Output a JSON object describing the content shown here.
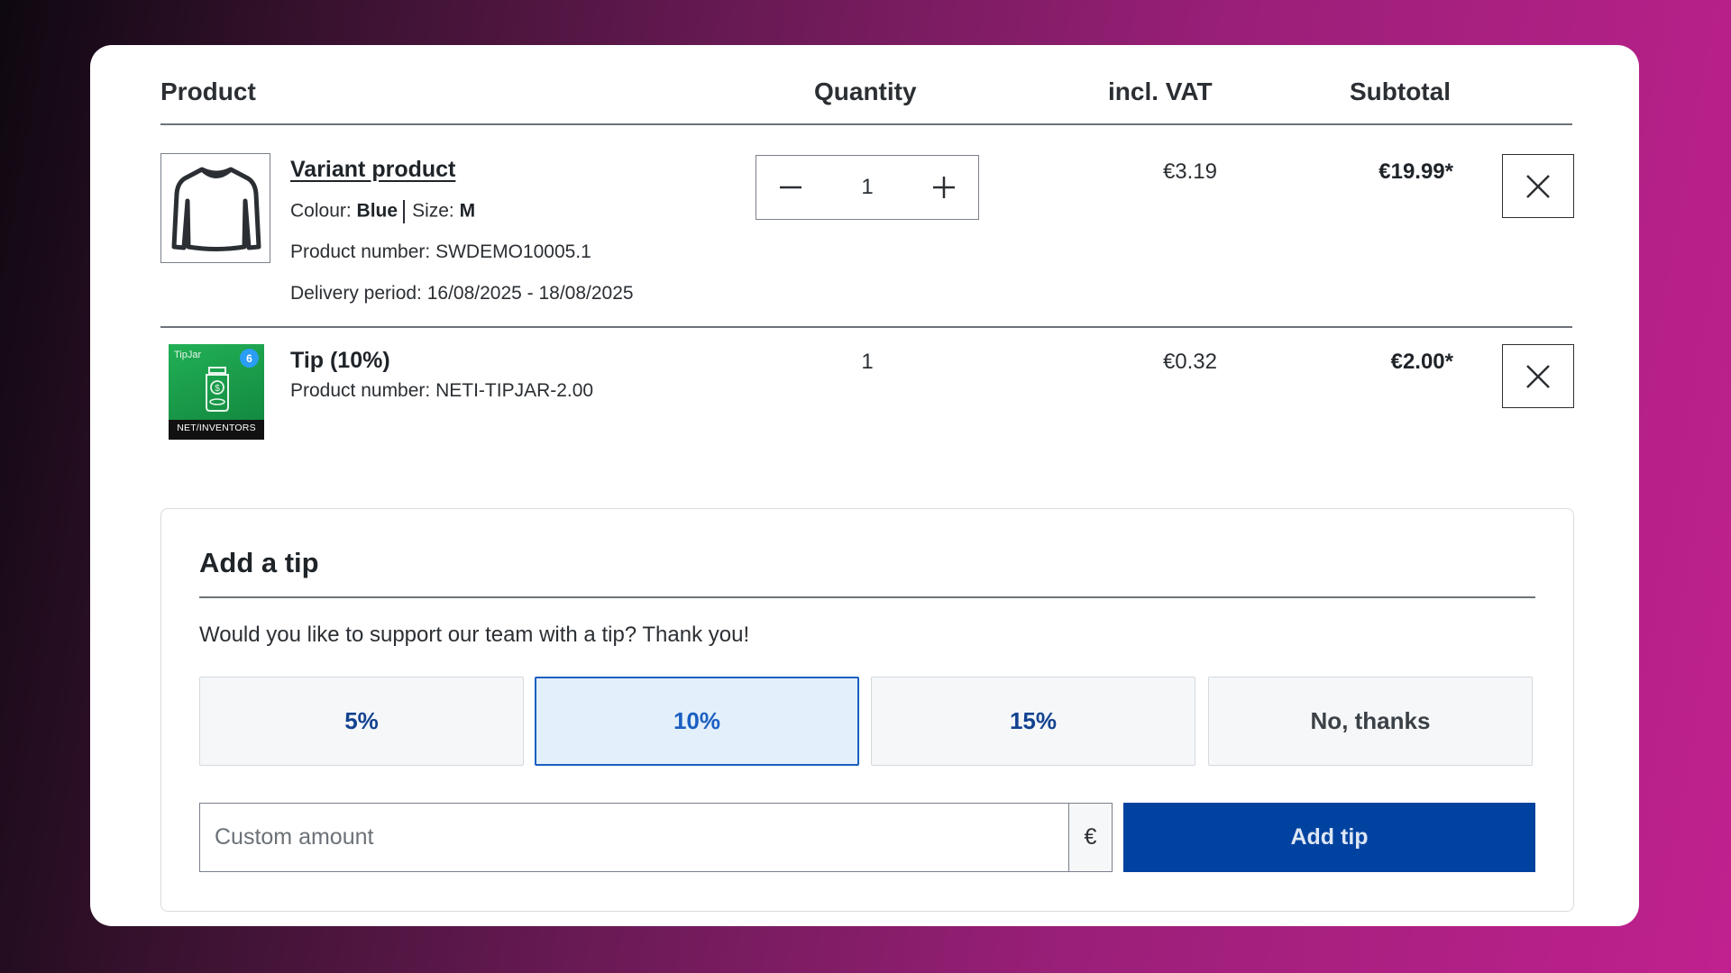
{
  "table": {
    "headers": {
      "product": "Product",
      "quantity": "Quantity",
      "vat": "incl. VAT",
      "subtotal": "Subtotal"
    },
    "items": [
      {
        "name": "Variant product",
        "option1_label": "Colour:",
        "option1_value": "Blue",
        "option2_label": "Size:",
        "option2_value": "M",
        "product_number": "Product number: SWDEMO10005.1",
        "delivery": "Delivery period: 16/08/2025 - 18/08/2025",
        "quantity": "1",
        "vat": "€3.19",
        "subtotal": "€19.99*",
        "thumbnail_icon": "sweater-icon"
      },
      {
        "name": "Tip (10%)",
        "product_number": "Product number: NETI-TIPJAR-2.00",
        "quantity": "1",
        "vat": "€0.32",
        "subtotal": "€2.00*",
        "thumbnail": {
          "label": "TipJar",
          "badge": "6",
          "brand": "NET/INVENTORS",
          "bg_color": "#1a9a4a"
        }
      }
    ]
  },
  "tip": {
    "title": "Add a tip",
    "text": "Would you like to support our team with a tip? Thank you!",
    "options": [
      "5%",
      "10%",
      "15%",
      "No, thanks"
    ],
    "selected": "10%",
    "custom_placeholder": "Custom amount",
    "currency": "€",
    "button": "Add tip"
  },
  "colors": {
    "primary": "#0042a0",
    "selected_border": "#1a5fc2",
    "selected_bg": "#e3effb"
  }
}
